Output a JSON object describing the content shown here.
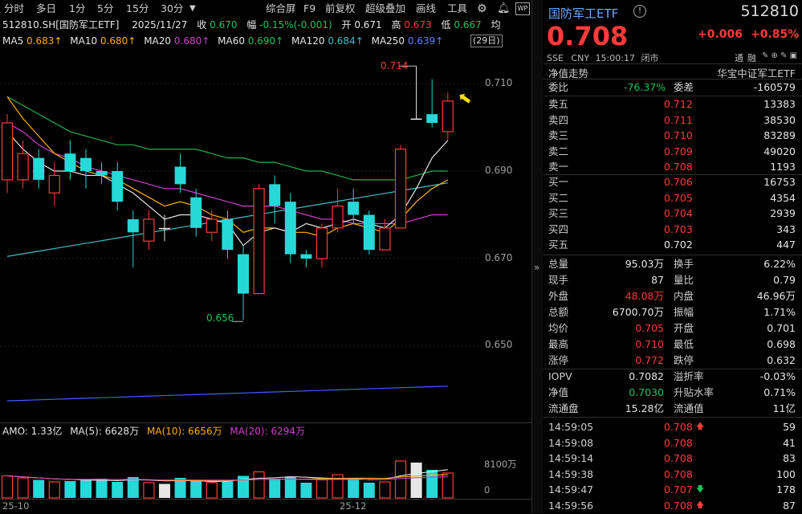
{
  "toolbar": {
    "tabs": [
      "分时",
      "多日",
      "1分",
      "5分",
      "15分",
      "30分"
    ],
    "dropdown_icon": "chevron-down-icon",
    "actions": [
      "综合屏",
      "F9",
      "前复权",
      "超级叠加",
      "画线",
      "工具"
    ],
    "gear_icon": "gear-icon",
    "bell_icon": "bell-icon",
    "wp_badge": "WP"
  },
  "info": {
    "code": "512810.SH[国防军工ETF]",
    "date": "2025/11/27",
    "close_label": "收",
    "close": "0.670",
    "range_label": "幅",
    "range": "-0.15%(-0.001)",
    "open_label": "开",
    "open": "0.671",
    "high_label": "高",
    "high": "0.673",
    "low_label": "低",
    "low": "0.667",
    "avg_label": "均"
  },
  "ma": {
    "ma5_label": "MA5",
    "ma5": "0.683↑",
    "ma10_label": "MA10",
    "ma10": "0.680↑",
    "ma20_label": "MA20",
    "ma20": "0.680↑",
    "ma60_label": "MA60",
    "ma60": "0.690↑",
    "ma120_label": "MA120",
    "ma120": "0.684↑",
    "ma250_label": "MA250",
    "ma250": "0.639↑",
    "days_badge": "(29日)"
  },
  "colors": {
    "up": "#ff3b3b",
    "down": "#27d8d8",
    "ma5": "#e6e6e6",
    "ma10": "#ffb000",
    "ma20": "#d040d0",
    "ma60": "#20b050",
    "ma120": "#40c0c8",
    "ma250": "#4060ff"
  },
  "price_axis": [
    "0.710",
    "0.690",
    "0.670",
    "0.650"
  ],
  "annotations": {
    "high_mark": "0.714",
    "low_mark": "0.656"
  },
  "amo": {
    "label": "AMO: 1.33亿",
    "ma5": "MA(5): 6628万",
    "ma10": "MA(10): 6656万",
    "ma20": "MA(20): 6294万",
    "axis_top": "8100万",
    "axis_zero": "0"
  },
  "date_axis": [
    "25-10",
    "25-12"
  ],
  "candles": [
    {
      "o": 0.688,
      "c": 0.701,
      "h": 0.703,
      "l": 0.685
    },
    {
      "o": 0.688,
      "c": 0.694,
      "h": 0.697,
      "l": 0.686
    },
    {
      "o": 0.693,
      "c": 0.688,
      "h": 0.695,
      "l": 0.686
    },
    {
      "o": 0.685,
      "c": 0.689,
      "h": 0.692,
      "l": 0.682
    },
    {
      "o": 0.694,
      "c": 0.69,
      "h": 0.697,
      "l": 0.688
    },
    {
      "o": 0.693,
      "c": 0.69,
      "h": 0.695,
      "l": 0.686
    },
    {
      "o": 0.69,
      "c": 0.689,
      "h": 0.692,
      "l": 0.687
    },
    {
      "o": 0.69,
      "c": 0.683,
      "h": 0.692,
      "l": 0.681
    },
    {
      "o": 0.679,
      "c": 0.676,
      "h": 0.681,
      "l": 0.668
    },
    {
      "o": 0.674,
      "c": 0.679,
      "h": 0.681,
      "l": 0.672
    },
    {
      "o": 0.677,
      "c": 0.677,
      "h": 0.68,
      "l": 0.674
    },
    {
      "o": 0.691,
      "c": 0.687,
      "h": 0.694,
      "l": 0.685
    },
    {
      "o": 0.684,
      "c": 0.677,
      "h": 0.686,
      "l": 0.675
    },
    {
      "o": 0.676,
      "c": 0.679,
      "h": 0.681,
      "l": 0.674
    },
    {
      "o": 0.679,
      "c": 0.672,
      "h": 0.681,
      "l": 0.67
    },
    {
      "o": 0.671,
      "c": 0.662,
      "h": 0.673,
      "l": 0.656
    },
    {
      "o": 0.662,
      "c": 0.686,
      "h": 0.687,
      "l": 0.662
    },
    {
      "o": 0.687,
      "c": 0.682,
      "h": 0.689,
      "l": 0.678
    },
    {
      "o": 0.683,
      "c": 0.671,
      "h": 0.685,
      "l": 0.669
    },
    {
      "o": 0.671,
      "c": 0.67,
      "h": 0.672,
      "l": 0.668
    },
    {
      "o": 0.67,
      "c": 0.677,
      "h": 0.678,
      "l": 0.668
    },
    {
      "o": 0.677,
      "c": 0.682,
      "h": 0.686,
      "l": 0.676
    },
    {
      "o": 0.683,
      "c": 0.68,
      "h": 0.686,
      "l": 0.678
    },
    {
      "o": 0.68,
      "c": 0.672,
      "h": 0.681,
      "l": 0.671
    },
    {
      "o": 0.672,
      "c": 0.677,
      "h": 0.679,
      "l": 0.672
    },
    {
      "o": 0.677,
      "c": 0.695,
      "h": 0.696,
      "l": 0.677
    },
    {
      "o": 0.702,
      "c": 0.702,
      "h": 0.714,
      "l": 0.702
    },
    {
      "o": 0.703,
      "c": 0.701,
      "h": 0.711,
      "l": 0.7
    },
    {
      "o": 0.699,
      "c": 0.706,
      "h": 0.708,
      "l": 0.697
    }
  ],
  "volumes": [
    55,
    50,
    45,
    40,
    42,
    45,
    48,
    40,
    52,
    38,
    35,
    50,
    42,
    38,
    45,
    55,
    65,
    48,
    52,
    38,
    45,
    58,
    48,
    38,
    40,
    92,
    88,
    70,
    62
  ],
  "quote": {
    "name": "国防军工ETF",
    "info_icon": "info-icon",
    "code": "512810",
    "price": "0.708",
    "change": "+0.006",
    "change_pct": "+0.85%",
    "market": "SSE",
    "currency": "CNY",
    "time": "15:00:17",
    "status": "闭市",
    "right_labels": [
      "通",
      "融"
    ],
    "netvalue_link": "净值走势",
    "index_name": "华宝中证军工ETF",
    "weibi_label": "委比",
    "weibi": "-76.37%",
    "weicha_label": "委差",
    "weicha": "-160579"
  },
  "asks": [
    {
      "label": "卖五",
      "price": "0.712",
      "vol": "13383"
    },
    {
      "label": "卖四",
      "price": "0.711",
      "vol": "38530"
    },
    {
      "label": "卖三",
      "price": "0.710",
      "vol": "83289"
    },
    {
      "label": "卖二",
      "price": "0.709",
      "vol": "49020"
    },
    {
      "label": "卖一",
      "price": "0.708",
      "vol": "1193"
    }
  ],
  "bids": [
    {
      "label": "买一",
      "price": "0.706",
      "vol": "16753"
    },
    {
      "label": "买二",
      "price": "0.705",
      "vol": "4354"
    },
    {
      "label": "买三",
      "price": "0.704",
      "vol": "2939"
    },
    {
      "label": "买四",
      "price": "0.703",
      "vol": "343"
    },
    {
      "label": "买五",
      "price": "0.702",
      "vol": "447"
    }
  ],
  "stats": [
    {
      "k1": "总量",
      "v1": "95.03万",
      "k2": "换手",
      "v2": "6.22%",
      "c1": "w",
      "c2": "w"
    },
    {
      "k1": "现手",
      "v1": "87",
      "k2": "量比",
      "v2": "0.79",
      "c1": "w",
      "c2": "w"
    },
    {
      "k1": "外盘",
      "v1": "48.08万",
      "k2": "内盘",
      "v2": "46.96万",
      "c1": "r",
      "c2": "g"
    },
    {
      "k1": "总额",
      "v1": "6700.70万",
      "k2": "振幅",
      "v2": "1.71%",
      "c1": "w",
      "c2": "w"
    },
    {
      "k1": "均价",
      "v1": "0.705",
      "k2": "开盘",
      "v2": "0.701",
      "c1": "r",
      "c2": "g"
    },
    {
      "k1": "最高",
      "v1": "0.710",
      "k2": "最低",
      "v2": "0.698",
      "c1": "r",
      "c2": "g"
    },
    {
      "k1": "涨停",
      "v1": "0.772",
      "k2": "跌停",
      "v2": "0.632",
      "c1": "r",
      "c2": "g"
    },
    {
      "k1": "IOPV",
      "v1": "0.7082",
      "k2": "溢折率",
      "v2": "-0.03%",
      "c1": "w",
      "c2": "g"
    },
    {
      "k1": "净值",
      "v1": "0.7030",
      "k2": "升贴水率",
      "v2": "0.71%",
      "c1": "g",
      "c2": "r"
    },
    {
      "k1": "流通盘",
      "v1": "15.28亿",
      "k2": "流通值",
      "v2": "11亿",
      "c1": "w",
      "c2": "w"
    }
  ],
  "ticks": [
    {
      "time": "14:59:05",
      "price": "0.708",
      "dir": "up",
      "vol": "59"
    },
    {
      "time": "14:59:08",
      "price": "0.708",
      "dir": "",
      "vol": "41"
    },
    {
      "time": "14:59:14",
      "price": "0.708",
      "dir": "",
      "vol": "83"
    },
    {
      "time": "14:59:38",
      "price": "0.708",
      "dir": "",
      "vol": "100"
    },
    {
      "time": "14:59:47",
      "price": "0.707",
      "dir": "down",
      "vol": "178"
    },
    {
      "time": "14:59:56",
      "price": "0.708",
      "dir": "up",
      "vol": "87"
    }
  ],
  "collapse_icon": "chevron-right-icon"
}
